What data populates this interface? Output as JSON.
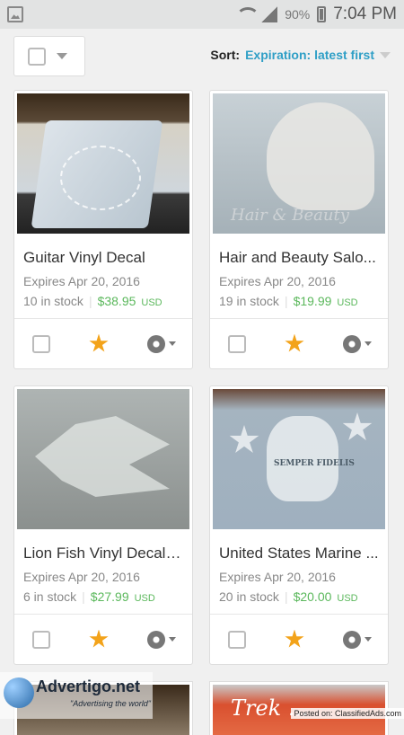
{
  "status_bar": {
    "battery_percent": "90%",
    "time": "7:04 PM"
  },
  "toolbar": {
    "sort_label": "Sort:",
    "sort_value": "Expiration: latest first"
  },
  "listings": [
    {
      "title": "Guitar Vinyl Decal",
      "expires": "Expires Apr 20, 2016",
      "stock": "10 in stock",
      "price": "$38.95",
      "currency": "USD",
      "starred": true
    },
    {
      "title": "Hair and Beauty Salo...",
      "expires": "Expires Apr 20, 2016",
      "stock": "19 in stock",
      "price": "$19.99",
      "currency": "USD",
      "starred": true,
      "image_text": "Hair & Beauty"
    },
    {
      "title": "Lion Fish Vinyl Decal l...",
      "expires": "Expires Apr 20, 2016",
      "stock": "6 in stock",
      "price": "$27.99",
      "currency": "USD",
      "starred": true
    },
    {
      "title": "United States Marine ...",
      "expires": "Expires Apr 20, 2016",
      "stock": "20 in stock",
      "price": "$20.00",
      "currency": "USD",
      "starred": true,
      "image_text": "SEMPER FIDELIS"
    }
  ],
  "partial_images": {
    "right_text": "Trek ..."
  },
  "watermark": {
    "brand": "Advertigo.net",
    "tagline": "\"Advertising the world\"",
    "posted": "Posted on: ClassifiedAds.com"
  },
  "colors": {
    "accent": "#2f9fc6",
    "price": "#5bb85c",
    "star": "#f3a31a"
  }
}
